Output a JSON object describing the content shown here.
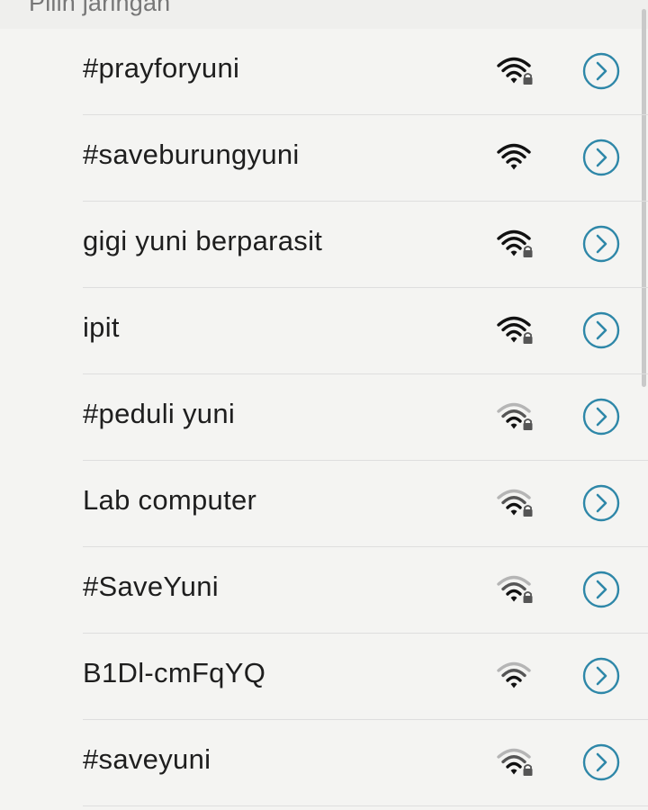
{
  "header": {
    "title": "Pilih jaringan"
  },
  "colors": {
    "accent": "#2e87a8",
    "text": "#1e1e1e",
    "divider": "#dedede"
  },
  "networks": [
    {
      "ssid": "#prayforyuni",
      "secured": true,
      "signal": "strong",
      "icon": "wifi-lock-icon",
      "action_icon": "chevron-right-circle-icon"
    },
    {
      "ssid": "#saveburungyuni",
      "secured": false,
      "signal": "strong",
      "icon": "wifi-icon",
      "action_icon": "chevron-right-circle-icon"
    },
    {
      "ssid": "gigi yuni berparasit",
      "secured": true,
      "signal": "strong",
      "icon": "wifi-lock-icon",
      "action_icon": "chevron-right-circle-icon"
    },
    {
      "ssid": "ipit",
      "secured": true,
      "signal": "strong",
      "icon": "wifi-lock-icon",
      "action_icon": "chevron-right-circle-icon"
    },
    {
      "ssid": "#peduli yuni",
      "secured": true,
      "signal": "medium",
      "icon": "wifi-lock-icon",
      "action_icon": "chevron-right-circle-icon"
    },
    {
      "ssid": "Lab computer",
      "secured": true,
      "signal": "medium",
      "icon": "wifi-lock-icon",
      "action_icon": "chevron-right-circle-icon"
    },
    {
      "ssid": "#SaveYuni",
      "secured": true,
      "signal": "medium",
      "icon": "wifi-lock-icon",
      "action_icon": "chevron-right-circle-icon"
    },
    {
      "ssid": "B1Dl-cmFqYQ",
      "secured": false,
      "signal": "medium",
      "icon": "wifi-icon",
      "action_icon": "chevron-right-circle-icon"
    },
    {
      "ssid": "#saveyuni",
      "secured": true,
      "signal": "medium",
      "icon": "wifi-lock-icon",
      "action_icon": "chevron-right-circle-icon"
    }
  ]
}
